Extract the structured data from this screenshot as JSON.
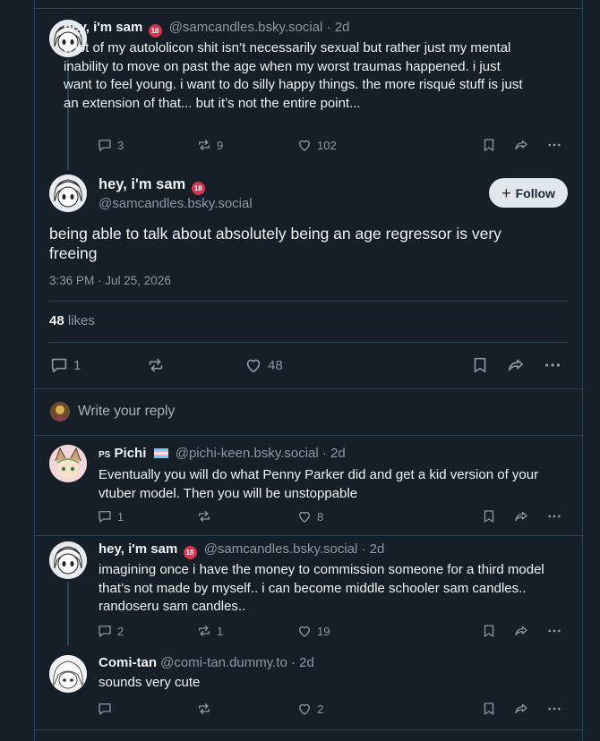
{
  "colors": {
    "background": "#161e27",
    "border": "#2e4052",
    "text": "#f1f3f5",
    "muted": "#8b98a5",
    "age_badge": "#d8334a",
    "follow_bg": "#e2e7ed"
  },
  "parent_post": {
    "display_name": "hey, i'm sam",
    "badge": "18",
    "handle": "@samcandles.bsky.social",
    "time": "· 2d",
    "text": "a lot of my autololicon shit isn’t necessarily sexual but rather just my mental inability to move on past the age when my worst traumas happened. i just want to feel young. i want to do silly happy things. the more risqué stuff is just an extension of that... but it’s not the entire point...",
    "replies": "3",
    "reposts": "9",
    "likes": "102"
  },
  "main_post": {
    "display_name": "hey, i'm sam",
    "badge": "18",
    "handle": "@samcandles.bsky.social",
    "follow_label": "Follow",
    "text": "being able to talk about absolutely being an age regressor is very freeing",
    "timestamp": "3:36 PM · Jul 25, 2026",
    "likes_count": "48",
    "likes_label": "likes",
    "replies": "1",
    "likes": "48"
  },
  "reply_prompt": "Write your reply",
  "replies": [
    {
      "prefix": "PS",
      "display_name": "Pichi",
      "flag": "trans-flag",
      "handle": "@pichi-keen.bsky.social",
      "time": "· 2d",
      "text": "Eventually you will do what Penny Parker did and get a kid version of your vtuber model. Then you will be unstoppable",
      "replies": "1",
      "reposts": "",
      "likes": "8"
    },
    {
      "display_name": "hey, i'm sam",
      "badge": "18",
      "handle": "@samcandles.bsky.social",
      "time": "· 2d",
      "text": "imagining once i have the money to commission someone for a third model that’s not made by myself.. i can become middle schooler sam candles.. randoseru sam candles..",
      "replies": "2",
      "reposts": "1",
      "likes": "19"
    },
    {
      "display_name": "Comi-tan",
      "handle": "@comi-tan.dummy.to",
      "time": "· 2d",
      "text": "sounds very cute",
      "replies": "",
      "reposts": "",
      "likes": "2"
    }
  ]
}
